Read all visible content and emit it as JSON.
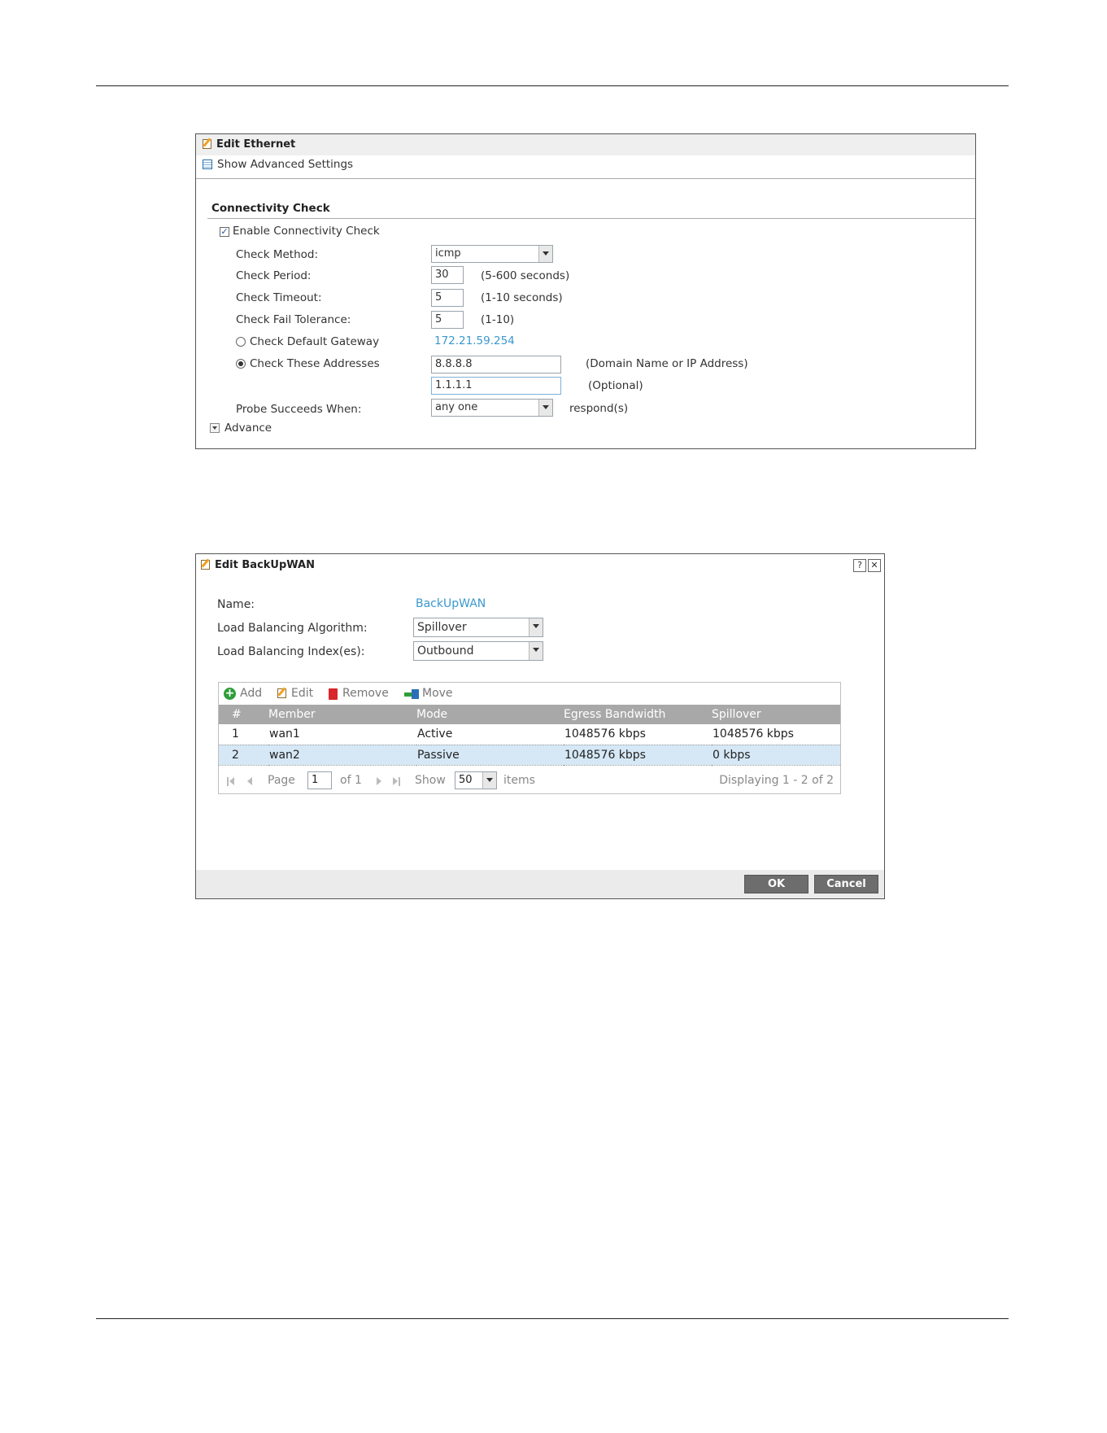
{
  "edit_ethernet": {
    "title": "Edit Ethernet",
    "show_advanced": "Show Advanced Settings",
    "section_title": "Connectivity Check",
    "enable_label": "Enable Connectivity Check",
    "enable_checked": true,
    "check_method": {
      "label": "Check Method:",
      "value": "icmp"
    },
    "check_period": {
      "label": "Check Period:",
      "value": "30",
      "hint": "(5-600 seconds)"
    },
    "check_timeout": {
      "label": "Check Timeout:",
      "value": "5",
      "hint": "(1-10 seconds)"
    },
    "check_fail_tolerance": {
      "label": "Check Fail Tolerance:",
      "value": "5",
      "hint": "(1-10)"
    },
    "default_gateway": {
      "label": "Check Default Gateway",
      "value": "172.21.59.254",
      "selected": false
    },
    "these_addresses": {
      "label": "Check These Addresses",
      "selected": true,
      "address1": "8.8.8.8",
      "address1_hint": "(Domain Name or IP Address)",
      "address2": "1.1.1.1",
      "address2_hint": "(Optional)"
    },
    "probe": {
      "label": "Probe Succeeds When:",
      "value": "any one",
      "suffix": "respond(s)"
    },
    "advance": "Advance"
  },
  "edit_backupwan": {
    "title": "Edit BackUpWAN",
    "help_icon": "?",
    "close_icon": "✕",
    "name": {
      "label": "Name:",
      "value": "BackUpWAN"
    },
    "algorithm": {
      "label": "Load Balancing Algorithm:",
      "value": "Spillover"
    },
    "index": {
      "label": "Load Balancing Index(es):",
      "value": "Outbound"
    },
    "toolbar": {
      "add": "Add",
      "edit": "Edit",
      "remove": "Remove",
      "move": "Move"
    },
    "table": {
      "headers": [
        "#",
        "Member",
        "Mode",
        "Egress Bandwidth",
        "Spillover"
      ],
      "rows": [
        [
          "1",
          "wan1",
          "Active",
          "1048576 kbps",
          "1048576 kbps"
        ],
        [
          "2",
          "wan2",
          "Passive",
          "1048576 kbps",
          "0 kbps"
        ]
      ]
    },
    "pager": {
      "page_label": "Page",
      "page_value": "1",
      "of_label": "of 1",
      "show_label": "Show",
      "show_value": "50",
      "items_label": "items",
      "displaying": "Displaying 1 - 2 of 2"
    },
    "ok": "OK",
    "cancel": "Cancel"
  }
}
